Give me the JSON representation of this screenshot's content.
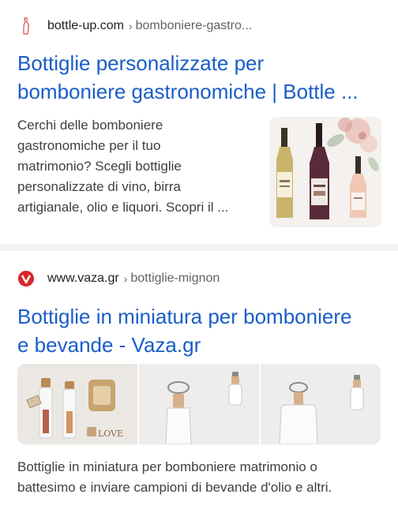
{
  "results": [
    {
      "domain": "bottle-up.com",
      "path": "bomboniere-gastro...",
      "title_line1": "Bottiglie personalizzate per",
      "title_line2": "bomboniere gastronomiche | Bottle ...",
      "snippet": [
        "Cerchi delle bomboniere",
        "gastronomiche per il tuo",
        "matrimonio? Scegli bottiglie",
        "personalizzate di vino, birra",
        "artigianale, olio e liquori. Scopri il ..."
      ],
      "favicon": "bottle-up-logo-icon",
      "thumbnail": "wine-bottles-image"
    },
    {
      "domain": "www.vaza.gr",
      "path": "bottiglie-mignon",
      "title_line1": "Bottiglie in miniatura per bomboniere",
      "title_line2": "e bevande - Vaza.gr",
      "snippet": [
        "Bottiglie in miniatura per bomboniere matrimonio o",
        "battesimo e inviare campioni di bevande d'olio e altri."
      ],
      "favicon": "vaza-logo-icon",
      "image_text": "LOVE"
    }
  ],
  "separator": "›",
  "colors": {
    "link": "#1a5dc7",
    "vaza_red": "#d9262e",
    "background": "#f1f3f4"
  }
}
